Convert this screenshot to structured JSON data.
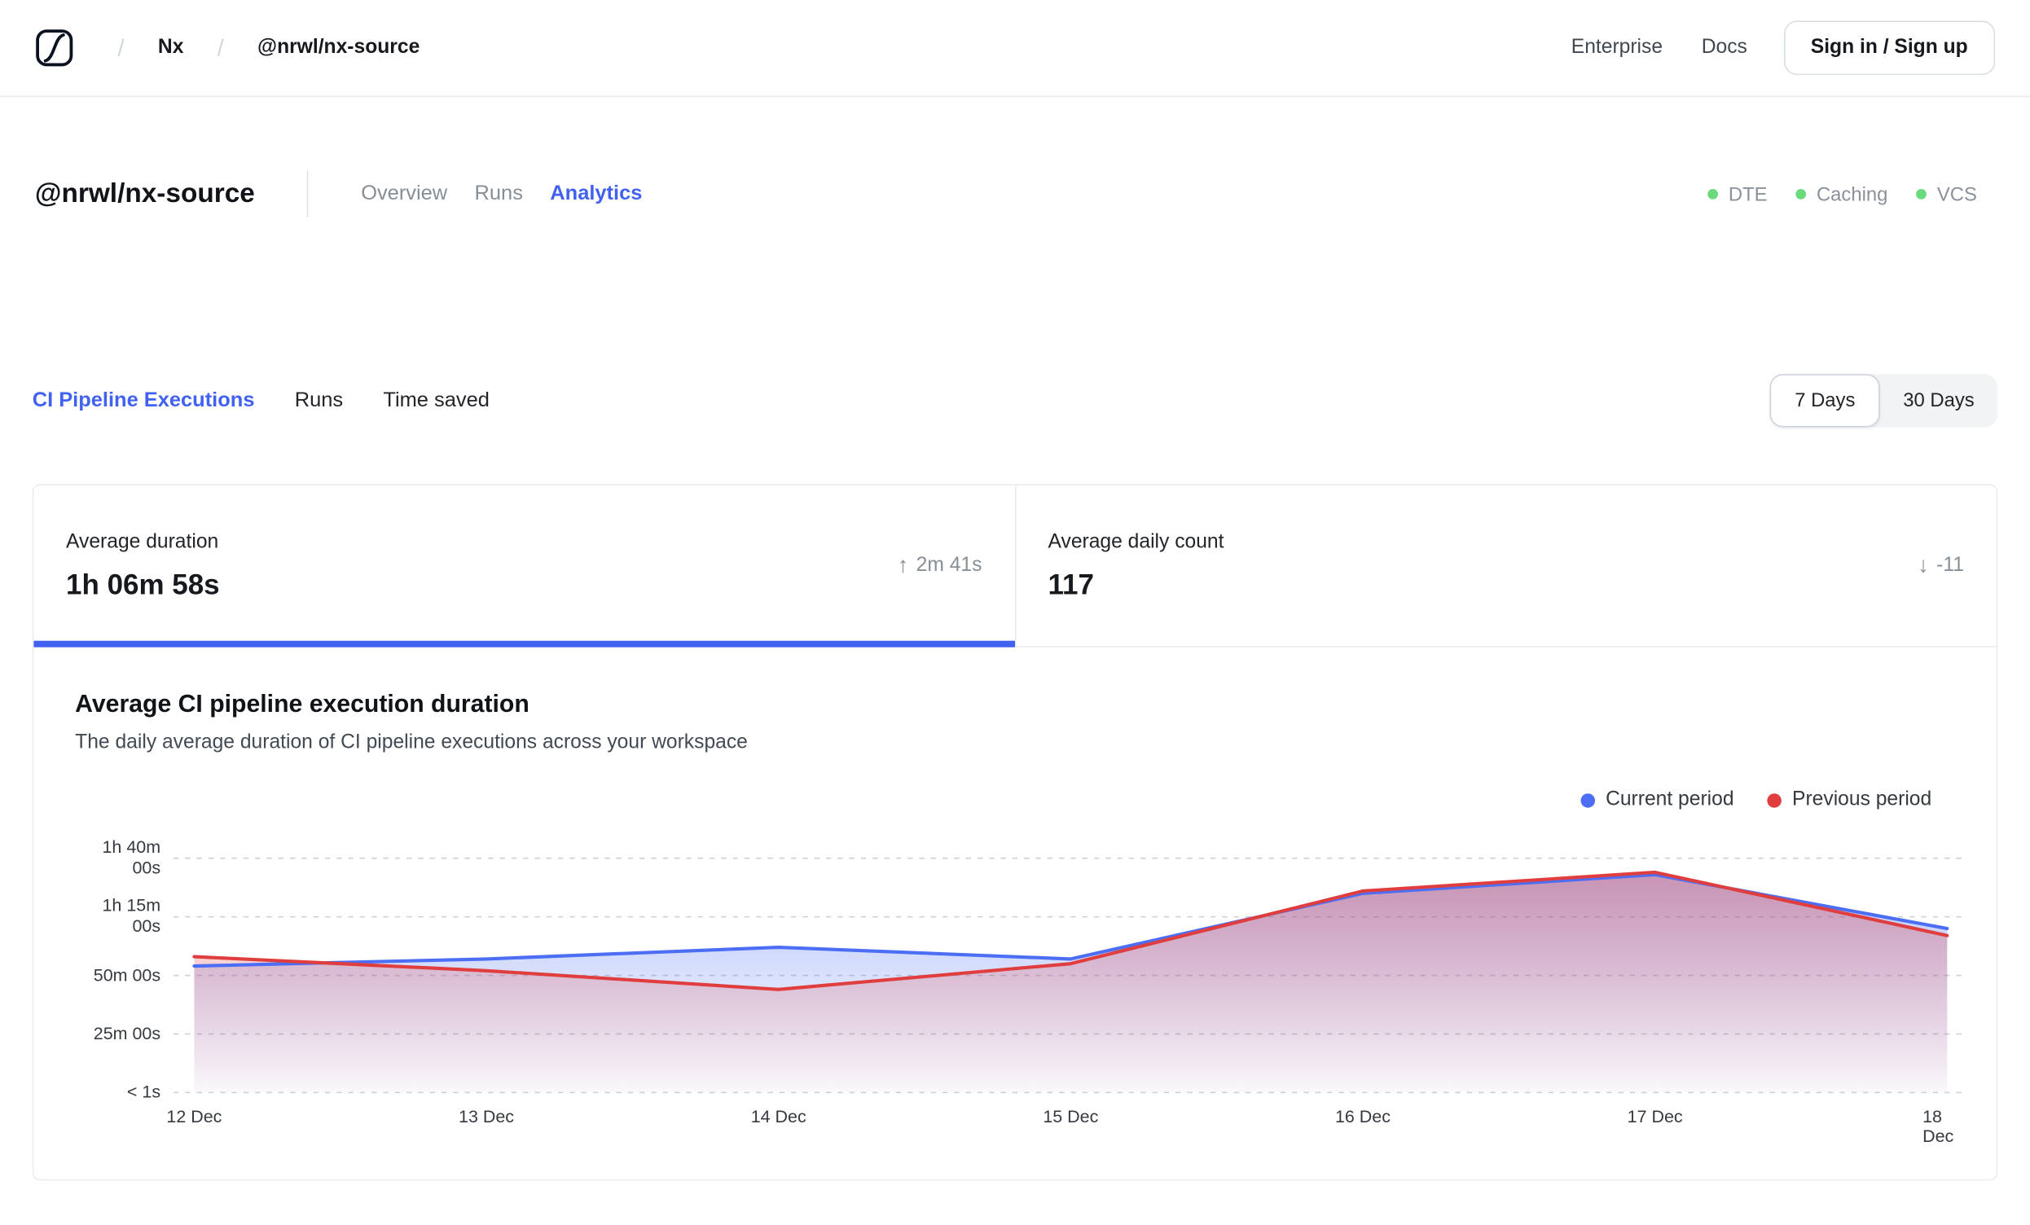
{
  "nav": {
    "breadcrumb": {
      "separator": "/",
      "items": [
        {
          "label": "Nx"
        },
        {
          "label": "@nrwl/nx-source"
        }
      ]
    },
    "links": [
      "Enterprise",
      "Docs"
    ],
    "signin_label": "Sign in / Sign up"
  },
  "header": {
    "title": "@nrwl/nx-source",
    "tabs": [
      {
        "label": "Overview",
        "active": false
      },
      {
        "label": "Runs",
        "active": false
      },
      {
        "label": "Analytics",
        "active": true
      }
    ],
    "statuses": [
      {
        "label": "DTE",
        "color": "#69db7c"
      },
      {
        "label": "Caching",
        "color": "#69db7c"
      },
      {
        "label": "VCS",
        "color": "#69db7c"
      }
    ]
  },
  "subtabs": [
    {
      "label": "CI Pipeline Executions",
      "active": true
    },
    {
      "label": "Runs",
      "active": false
    },
    {
      "label": "Time saved",
      "active": false
    }
  ],
  "range_toggle": {
    "options": [
      {
        "label": "7 Days",
        "selected": true
      },
      {
        "label": "30 Days",
        "selected": false
      }
    ]
  },
  "cards": [
    {
      "label": "Average duration",
      "value": "1h 06m 58s",
      "delta": "2m 41s",
      "direction": "up",
      "selected": true
    },
    {
      "label": "Average daily count",
      "value": "117",
      "delta": "-11",
      "direction": "down",
      "selected": false
    }
  ],
  "chart_data": {
    "type": "line",
    "title": "Average CI pipeline execution duration",
    "subtitle": "The daily average duration of CI pipeline executions across your workspace",
    "x": [
      "12 Dec",
      "13 Dec",
      "14 Dec",
      "15 Dec",
      "16 Dec",
      "17 Dec",
      "18 Dec"
    ],
    "y_unit": "minutes",
    "ylim": [
      0,
      100
    ],
    "yticks": {
      "values": [
        100,
        75,
        50,
        25,
        0
      ],
      "labels": [
        "1h 40m 00s",
        "1h 15m 00s",
        "50m 00s",
        "25m 00s",
        "< 1s"
      ]
    },
    "grid": "dashed-horizontal",
    "legend_position": "top-right",
    "series": [
      {
        "name": "Current period",
        "color": "#4c6ef5",
        "values": [
          54,
          57,
          62,
          57,
          85,
          93,
          70
        ]
      },
      {
        "name": "Previous period",
        "color": "#e03e3e",
        "values": [
          58,
          52,
          44,
          55,
          86,
          94,
          67
        ]
      }
    ]
  },
  "colors": {
    "accent": "#4161f1",
    "status_green": "#69db7c",
    "muted_text": "#868e96",
    "border": "#e9ecef"
  }
}
